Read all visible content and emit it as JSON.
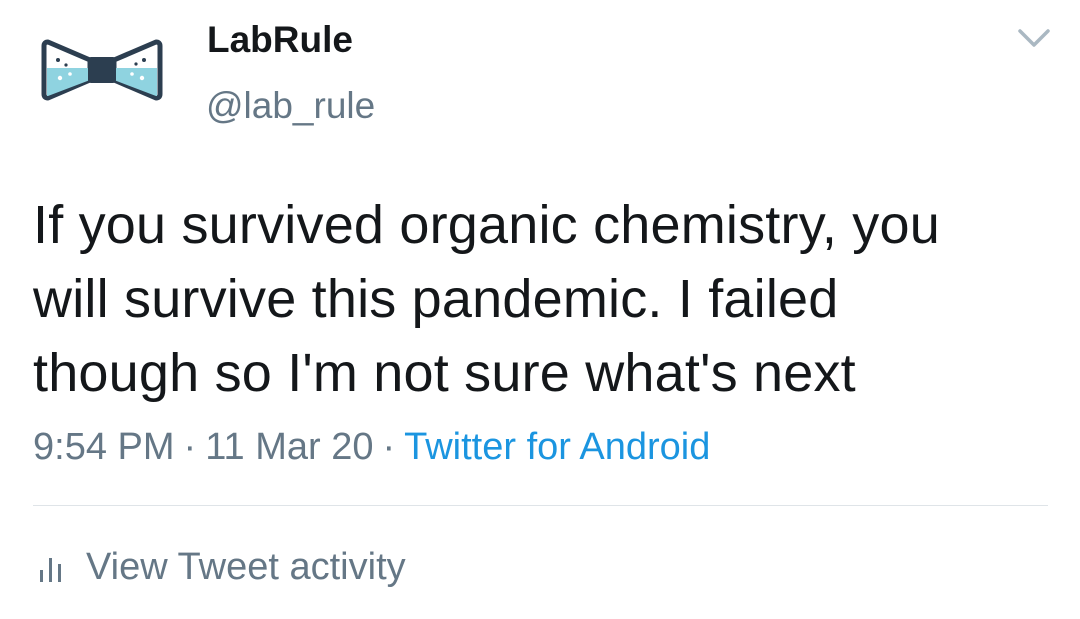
{
  "author": {
    "display_name": "LabRule",
    "handle": "@lab_rule",
    "avatar_icon": "bowtie-flask-logo"
  },
  "tweet": {
    "text_lines": [
      "If you survived organic chemistry, you",
      "will survive this pandemic. I failed",
      "though so I'm not sure what's next"
    ],
    "time": "9:54 PM",
    "date": "11 Mar 20",
    "separator": "·",
    "source": "Twitter for Android"
  },
  "actions": {
    "more_icon": "chevron-down-icon",
    "activity_icon": "bar-chart-icon",
    "activity_label": "View Tweet activity"
  },
  "colors": {
    "text": "#14171a",
    "secondary": "#657786",
    "link": "#1b95e0",
    "divider": "#dfe4e8",
    "logo_fill": "#8fd3e0",
    "logo_stroke": "#2c3e50"
  }
}
